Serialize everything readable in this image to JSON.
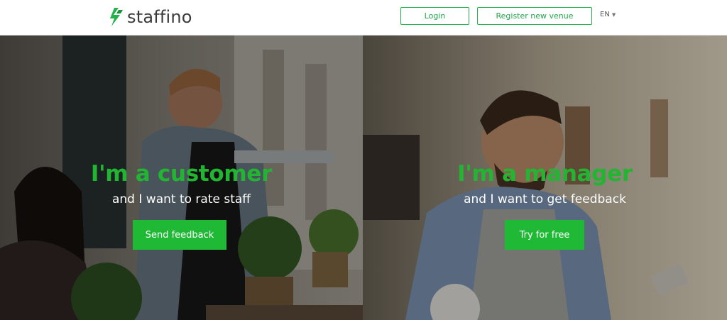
{
  "header": {
    "logo_text": "staffino",
    "login_label": "Login",
    "register_label": "Register new venue",
    "language": "EN"
  },
  "customer": {
    "title": "I'm a customer",
    "subtitle": "and I want to rate staff",
    "button_label": "Send feedback"
  },
  "manager": {
    "title": "I'm a manager",
    "subtitle": "and I want to get feedback",
    "button_label": "Try for free"
  },
  "colors": {
    "brand_green": "#1fb936",
    "title_green": "#22b532"
  },
  "icons": {
    "logo": "staffino-logo-icon",
    "language_caret": "caret-down-icon"
  }
}
